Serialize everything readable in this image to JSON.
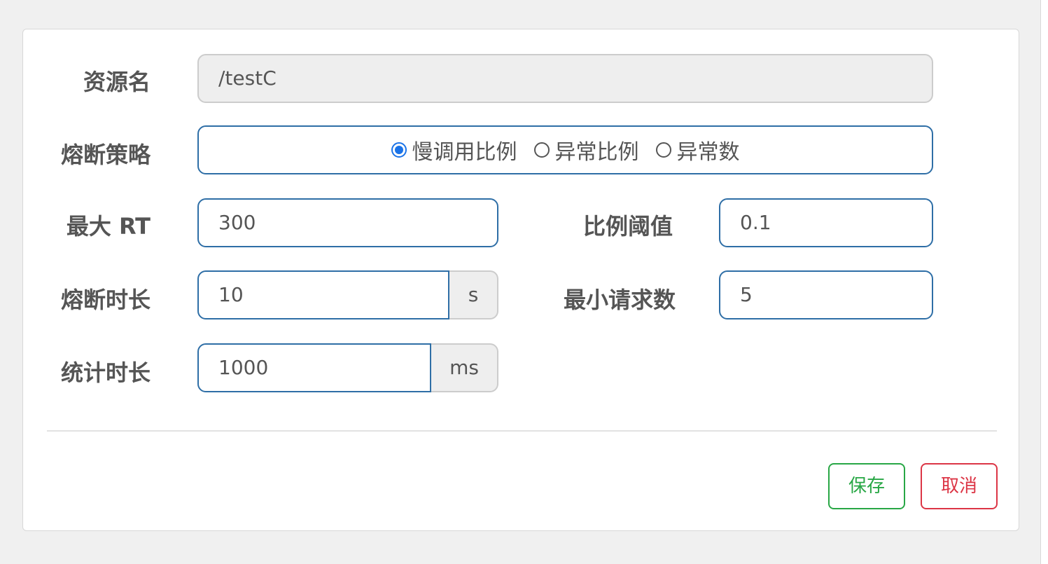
{
  "form": {
    "resource": {
      "label": "资源名",
      "value": "/testC"
    },
    "strategy": {
      "label": "熔断策略",
      "options": [
        {
          "label": "慢调用比例",
          "checked": true
        },
        {
          "label": "异常比例",
          "checked": false
        },
        {
          "label": "异常数",
          "checked": false
        }
      ]
    },
    "max_rt": {
      "label": "最大 RT",
      "value": "300"
    },
    "ratio_threshold": {
      "label": "比例阈值",
      "value": "0.1"
    },
    "break_duration": {
      "label": "熔断时长",
      "value": "10",
      "unit": "s"
    },
    "min_requests": {
      "label": "最小请求数",
      "value": "5"
    },
    "stat_duration": {
      "label": "统计时长",
      "value": "1000",
      "unit": "ms"
    }
  },
  "footer": {
    "save_label": "保存",
    "cancel_label": "取消"
  },
  "colors": {
    "primary_border": "#2e6ea6",
    "radio_checked": "#1a73e8",
    "save": "#28a745",
    "cancel": "#dc3545"
  }
}
